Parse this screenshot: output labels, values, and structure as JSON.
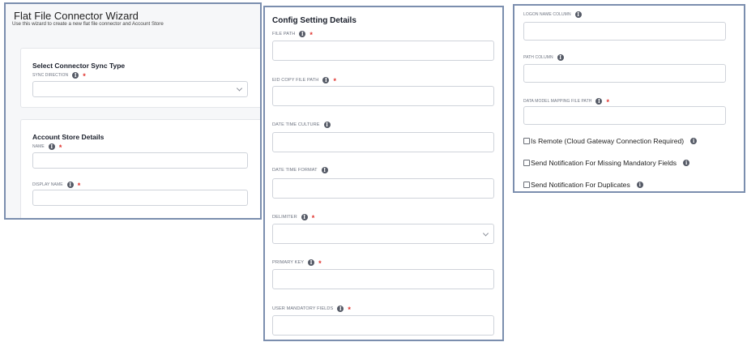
{
  "wizard": {
    "title": "Flat File Connector Wizard",
    "subtitle": "Use this wizard to create a new flat file connector and Account Store",
    "sync_section": {
      "title": "Select Connector Sync Type",
      "sync_direction_label": "SYNC DIRECTION",
      "sync_direction_value": ""
    },
    "account_section": {
      "title": "Account Store Details",
      "name_label": "NAME",
      "name_value": "",
      "display_name_label": "DISPLAY NAME",
      "display_name_value": ""
    }
  },
  "config": {
    "title": "Config Setting Details",
    "fields": [
      {
        "label": "FILE PATH",
        "required": true,
        "type": "text",
        "value": ""
      },
      {
        "label": "EID COPY FILE PATH",
        "required": true,
        "type": "text",
        "value": ""
      },
      {
        "label": "DATE TIME CULTURE",
        "required": false,
        "type": "text",
        "value": ""
      },
      {
        "label": "DATE TIME FORMAT",
        "required": false,
        "type": "text",
        "value": ""
      },
      {
        "label": "DELIMITER",
        "required": true,
        "type": "select",
        "value": ""
      },
      {
        "label": "PRIMARY KEY",
        "required": true,
        "type": "text",
        "value": ""
      },
      {
        "label": "USER MANDATORY FIELDS",
        "required": true,
        "type": "text",
        "value": ""
      }
    ]
  },
  "extra": {
    "fields": [
      {
        "label": "LOGON NAME COLUMN",
        "required": false,
        "value": ""
      },
      {
        "label": "PATH COLUMN",
        "required": false,
        "value": ""
      },
      {
        "label": "DATA MODEL MAPPING FILE PATH",
        "required": true,
        "value": ""
      }
    ],
    "checkboxes": [
      {
        "label": "Is Remote (Cloud Gateway Connection Required)",
        "checked": false
      },
      {
        "label": "Send Notification For Missing Mandatory Fields",
        "checked": false
      },
      {
        "label": "Send Notification For Duplicates",
        "checked": false
      }
    ]
  },
  "symbols": {
    "info_glyph": "i",
    "required_glyph": "*"
  },
  "colors": {
    "panel_border": "#7b8eae",
    "required": "#e0322d",
    "info_icon": "#555a66"
  }
}
